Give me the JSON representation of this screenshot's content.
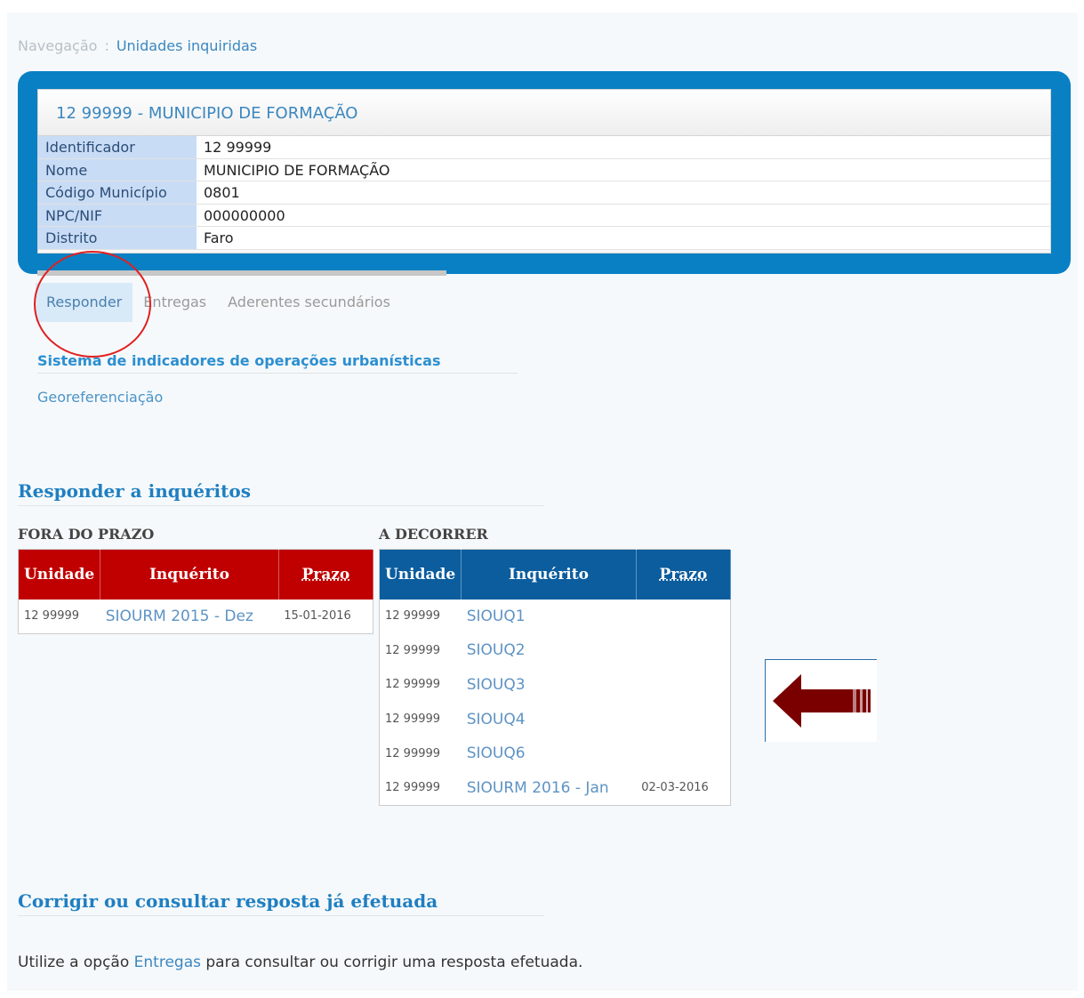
{
  "breadcrumb": {
    "label": "Navegação",
    "separator": ":",
    "current": "Unidades inquiridas"
  },
  "entity": {
    "title": "12 99999 - MUNICIPIO DE FORMAÇÃO",
    "fields": [
      {
        "key": "Identificador",
        "value": "12 99999"
      },
      {
        "key": "Nome",
        "value": "MUNICIPIO DE FORMAÇÃO"
      },
      {
        "key": "Código Município",
        "value": "0801"
      },
      {
        "key": "NPC/NIF",
        "value": "000000000"
      },
      {
        "key": "Distrito",
        "value": "Faro"
      }
    ]
  },
  "tabs": [
    {
      "label": "Responder",
      "active": true
    },
    {
      "label": "Entregas",
      "active": false
    },
    {
      "label": "Aderentes secundários",
      "active": false
    }
  ],
  "sections": {
    "indicators_link": "Sistema de indicadores de operações urbanísticas",
    "georef_link": "Georeferenciação"
  },
  "respond": {
    "heading": "Responder a inquéritos",
    "overdue": {
      "label": "FORA DO PRAZO",
      "headers": [
        "Unidade",
        "Inquérito",
        "Prazo"
      ],
      "rows": [
        {
          "unit": "12 99999",
          "survey": "SIOURM 2015 - Dez",
          "deadline": "15-01-2016"
        }
      ]
    },
    "current": {
      "label": "A DECORRER",
      "headers": [
        "Unidade",
        "Inquérito",
        "Prazo"
      ],
      "rows": [
        {
          "unit": "12 99999",
          "survey": "SIOUQ1",
          "deadline": ""
        },
        {
          "unit": "12 99999",
          "survey": "SIOUQ2",
          "deadline": ""
        },
        {
          "unit": "12 99999",
          "survey": "SIOUQ3",
          "deadline": ""
        },
        {
          "unit": "12 99999",
          "survey": "SIOUQ4",
          "deadline": ""
        },
        {
          "unit": "12 99999",
          "survey": "SIOUQ6",
          "deadline": ""
        },
        {
          "unit": "12 99999",
          "survey": "SIOURM 2016 - Jan",
          "deadline": "02-03-2016"
        }
      ]
    }
  },
  "correct": {
    "heading": "Corrigir ou consultar resposta já efetuada",
    "note_before": "Utilize a opção ",
    "note_link": "Entregas",
    "note_after": " para consultar ou corrigir uma resposta efetuada."
  },
  "colors": {
    "card_blue": "#0a80c4",
    "overdue_red": "#c00000",
    "current_blue": "#0b5d9e",
    "arrow": "#7a0000",
    "highlight_circle": "#e02020"
  },
  "icons": {
    "arrow": "arrow-left-icon"
  }
}
